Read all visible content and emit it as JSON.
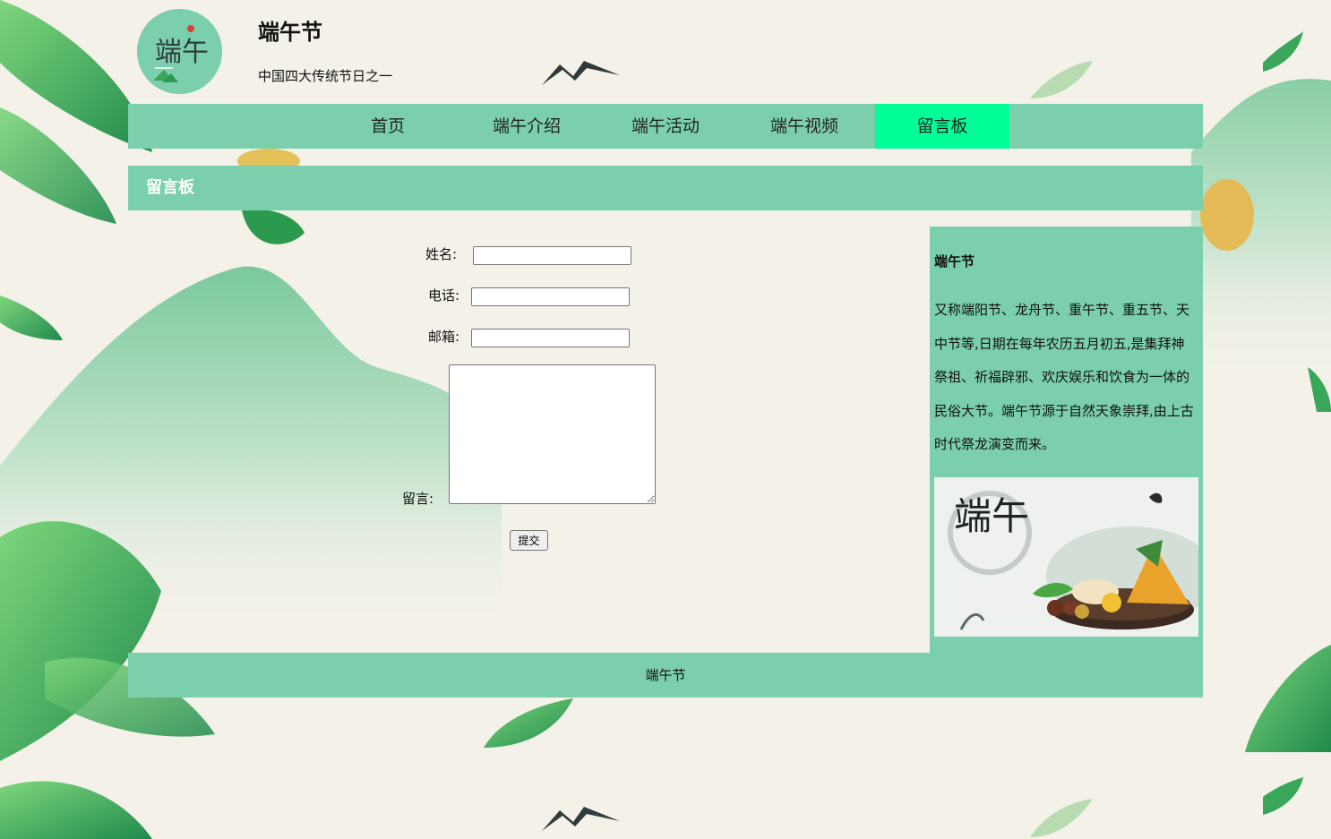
{
  "site": {
    "title": "端午节",
    "subtitle": "中国四大传统节日之一",
    "logo_text": "端午"
  },
  "nav": {
    "items": [
      {
        "label": "首页",
        "active": false
      },
      {
        "label": "端午介绍",
        "active": false
      },
      {
        "label": "端午活动",
        "active": false
      },
      {
        "label": "端午视频",
        "active": false
      },
      {
        "label": "留言板",
        "active": true
      }
    ]
  },
  "section": {
    "title": "留言板"
  },
  "form": {
    "name_label": "姓名:",
    "phone_label": "电话:",
    "email_label": "邮箱:",
    "message_label": "留言:",
    "submit_label": "提交",
    "name_value": "",
    "phone_value": "",
    "email_value": "",
    "message_value": ""
  },
  "sidebar": {
    "title": "端午节",
    "text": "又称端阳节、龙舟节、重午节、重五节、天中节等,日期在每年农历五月初五,是集拜神祭祖、祈福辟邪、欢庆娱乐和饮食为一体的民俗大节。端午节源于自然天象崇拜,由上古时代祭龙演变而来。",
    "image_text": "端午"
  },
  "footer": {
    "text": "端午节"
  },
  "colors": {
    "accent": "#7bcfac",
    "active_tab": "#00ff99",
    "background": "#f3f1e8"
  }
}
